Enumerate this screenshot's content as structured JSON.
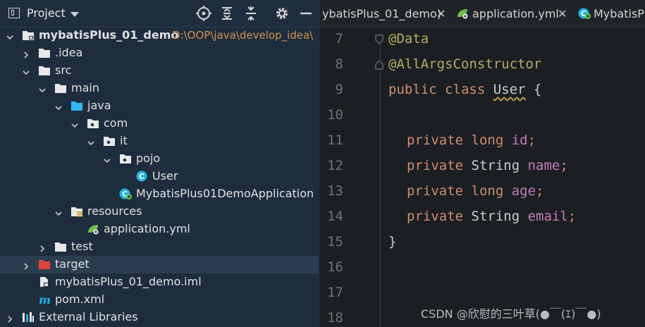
{
  "project_panel": {
    "title": "Project",
    "toolbar": [
      "locate-icon",
      "expand-all-icon",
      "collapse-all-icon",
      "settings-icon",
      "hide-icon"
    ],
    "tree": [
      {
        "label": "mybatisPlus_01_demo",
        "path": "D:\\OOP\\java\\develop_idea\\",
        "bold": true,
        "expanded": true
      },
      {
        "label": ".idea",
        "expanded": false
      },
      {
        "label": "src",
        "expanded": true
      },
      {
        "label": "main",
        "expanded": true
      },
      {
        "label": "java",
        "expanded": true
      },
      {
        "label": "com",
        "expanded": true
      },
      {
        "label": "it",
        "expanded": true
      },
      {
        "label": "pojo",
        "expanded": true
      },
      {
        "label": "User"
      },
      {
        "label": "MybatisPlus01DemoApplication"
      },
      {
        "label": "resources",
        "expanded": true
      },
      {
        "label": "application.yml"
      },
      {
        "label": "test",
        "expanded": false
      },
      {
        "label": "target",
        "expanded": false,
        "selected": true
      },
      {
        "label": "mybatisPlus_01_demo.iml"
      },
      {
        "label": "pom.xml"
      },
      {
        "label": "External Libraries",
        "expanded": false
      }
    ]
  },
  "editor": {
    "tabs": [
      {
        "label": "ybatisPlus_01_demo)",
        "close": "✕"
      },
      {
        "label": "application.yml",
        "close": "✕"
      },
      {
        "label": "MybatisPl",
        "close": ""
      }
    ],
    "line_numbers": [
      "7",
      "8",
      "9",
      "10",
      "11",
      "12",
      "13",
      "14",
      "15",
      "16",
      "17",
      "18"
    ],
    "code": {
      "l7": "@Data",
      "l8": "@AllArgsConstructor",
      "l9": [
        "public class ",
        "User",
        " {"
      ],
      "l11": [
        "private ",
        "long ",
        "id",
        ";"
      ],
      "l12": [
        "private ",
        "String ",
        "name",
        ";"
      ],
      "l13": [
        "private ",
        "long ",
        "age",
        ";"
      ],
      "l14": [
        "private ",
        "String ",
        "email",
        ";"
      ],
      "l15": "}"
    }
  },
  "watermark": "CSDN @欣慰的三叶草(●￣(ｴ)￣●)",
  "colors": {
    "panel_bg": "#1e2d3d",
    "editor_bg": "#1b1e23",
    "annotation": "#b3ae60",
    "keyword": "#cf8e6d",
    "field": "#c77dbb",
    "path": "#d3914e",
    "folder_blue": "#35b6f2",
    "folder_red": "#e0443c",
    "class_cyan": "#21b4e6"
  }
}
